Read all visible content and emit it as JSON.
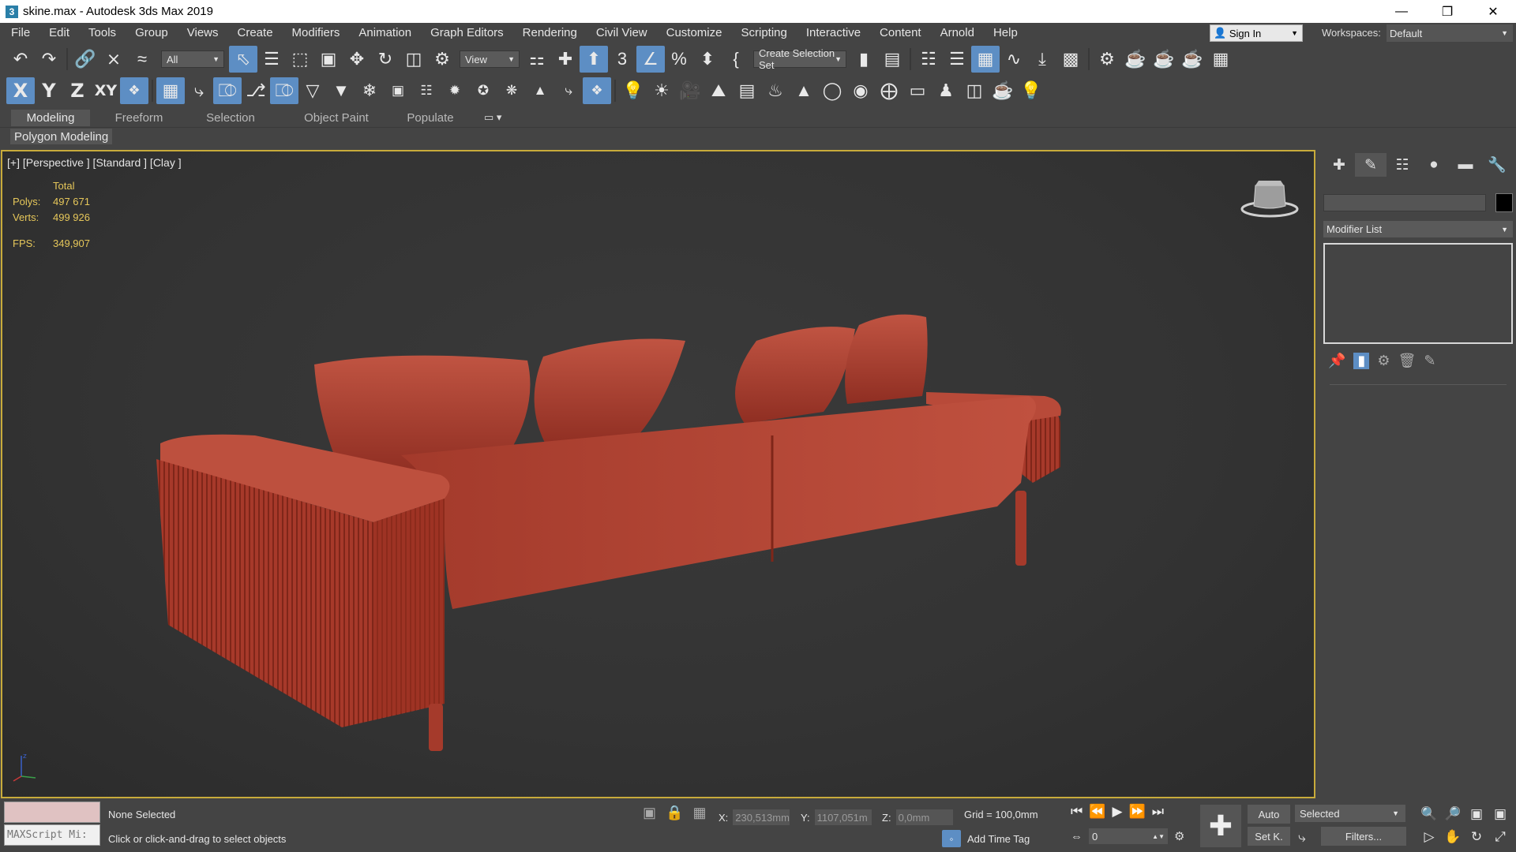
{
  "window": {
    "title": "skine.max - Autodesk 3ds Max 2019",
    "app_icon": "3",
    "controls": [
      "—",
      "❐",
      "✕"
    ]
  },
  "menu": [
    "File",
    "Edit",
    "Tools",
    "Group",
    "Views",
    "Create",
    "Modifiers",
    "Animation",
    "Graph Editors",
    "Rendering",
    "Civil View",
    "Customize",
    "Scripting",
    "Interactive",
    "Content",
    "Arnold",
    "Help"
  ],
  "account": {
    "signin_label": "Sign In",
    "workspaces_label": "Workspaces:",
    "workspace_value": "Default"
  },
  "toolbar": {
    "filter_value": "All",
    "refcoord_value": "View",
    "selection_set_value": "Create Selection Set"
  },
  "axis_constraints": [
    "X",
    "Y",
    "Z",
    "XY"
  ],
  "ribbon": {
    "tabs": [
      "Modeling",
      "Freeform",
      "Selection",
      "Object Paint",
      "Populate"
    ],
    "active_tab": "Modeling",
    "sub_panel": "Polygon Modeling"
  },
  "viewport": {
    "label": "[+] [Perspective ] [Standard ] [Clay ]",
    "stats_header": "Total",
    "polys_label": "Polys:",
    "polys_value": "497 671",
    "verts_label": "Verts:",
    "verts_value": "499 926",
    "fps_label": "FPS:",
    "fps_value": "349,907",
    "object_color": "#b03a2e",
    "border_color": "#c8ab3b"
  },
  "command_panel": {
    "modifier_list_label": "Modifier List"
  },
  "status": {
    "selection": "None Selected",
    "prompt": "Click or click-and-drag to select objects",
    "maxscript_placeholder": "MAXScript Mi:",
    "x_label": "X:",
    "x_value": "230,513mm",
    "y_label": "Y:",
    "y_value": "1107,051m",
    "z_label": "Z:",
    "z_value": "0,0mm",
    "grid": "Grid = 100,0mm",
    "add_time_tag": "Add Time Tag",
    "frame_value": "0",
    "auto_label": "Auto",
    "setk_label": "Set K.",
    "selected_label": "Selected",
    "filters_label": "Filters..."
  }
}
